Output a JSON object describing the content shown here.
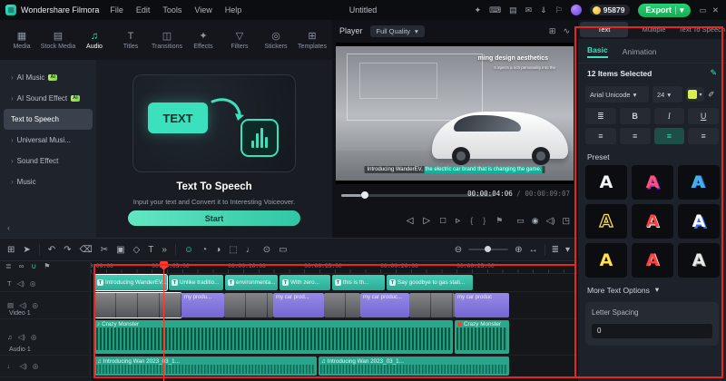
{
  "colors": {
    "accent_teal": "#3be0bd",
    "export_green": "#1fc262",
    "annotation_red": "#e8251f",
    "clip_purple": "#8274dd",
    "clip_teal": "#33c3ad",
    "audio_green": "#2aa88b",
    "coin_yellow": "#f2c029"
  },
  "titlebar": {
    "app_name": "Wondershare Filmora",
    "menus": [
      "File",
      "Edit",
      "Tools",
      "View",
      "Help"
    ],
    "project_title": "Untitled",
    "points": "95879",
    "export_label": "Export"
  },
  "media_tabs": [
    {
      "label": "Media"
    },
    {
      "label": "Stock Media"
    },
    {
      "label": "Audio"
    },
    {
      "label": "Titles"
    },
    {
      "label": "Transitions"
    },
    {
      "label": "Effects"
    },
    {
      "label": "Filters"
    },
    {
      "label": "Stickers"
    },
    {
      "label": "Templates"
    }
  ],
  "sidebar": {
    "items": [
      {
        "label": "AI Music",
        "badge": "AI"
      },
      {
        "label": "AI Sound Effect",
        "badge": "AI"
      },
      {
        "label": "Text to Speech"
      },
      {
        "label": "Universal Musi..."
      },
      {
        "label": "Sound Effect"
      },
      {
        "label": "Music"
      }
    ]
  },
  "tts": {
    "graphic_text": "TEXT",
    "title": "Text To Speech",
    "subtitle": "Input your text and Convert it to Interesting Voiceover.",
    "start_label": "Start"
  },
  "player": {
    "label": "Player",
    "quality": "Full Quality",
    "overlay_line1": "ming design aesthetics",
    "overlay_line2": "It injects a rich personality into the",
    "caption_part1": "Introducing WanderEV, ",
    "caption_part2": "the electric car brand that is changing the game.",
    "timecode_current": "00:00:04:06",
    "timecode_total": " / 00:00:09:07"
  },
  "text_panel": {
    "tabs": [
      "Text",
      "Multiple",
      "Text To Speech"
    ],
    "subtabs": [
      "Basic",
      "Animation"
    ],
    "items_selected": "12 Items Selected",
    "font_name": "Arial Unicode",
    "font_size": "24",
    "preset_label": "Preset",
    "presets": [
      "A",
      "A",
      "A",
      "A",
      "A",
      "A",
      "A",
      "A",
      "A"
    ],
    "more_text_options": "More Text Options",
    "letter_spacing_label": "Letter Spacing",
    "letter_spacing_value": "0"
  },
  "timeline": {
    "ruler": [
      "00:00:00:00",
      "00:00:05:00",
      "00:00:10:00",
      "00:00:15:00",
      "00:00:20:00",
      "00:00:25:00"
    ],
    "track_video_label": "Video 1",
    "track_audio_label": "Audio 1",
    "text_clips": [
      {
        "label": "Introducing WanderEV..."
      },
      {
        "label": "Unlike traditio..."
      },
      {
        "label": "environmenta..."
      },
      {
        "label": "With zero..."
      },
      {
        "label": "this is th..."
      },
      {
        "label": "Say goodbye to gas stati..."
      }
    ],
    "video_clips": [
      {
        "label": "my produ..."
      },
      {
        "label": "my car prod..."
      },
      {
        "label": "my car produc..."
      },
      {
        "label": "my car produc"
      }
    ],
    "music_clips": [
      {
        "label": "Crazy Monster"
      },
      {
        "label": "Crazy Monster"
      }
    ],
    "voice_clips": [
      {
        "label": "Introducing Wan 2023_03_1..."
      },
      {
        "label": "Introducing Wan 2023_03_1..."
      }
    ]
  }
}
